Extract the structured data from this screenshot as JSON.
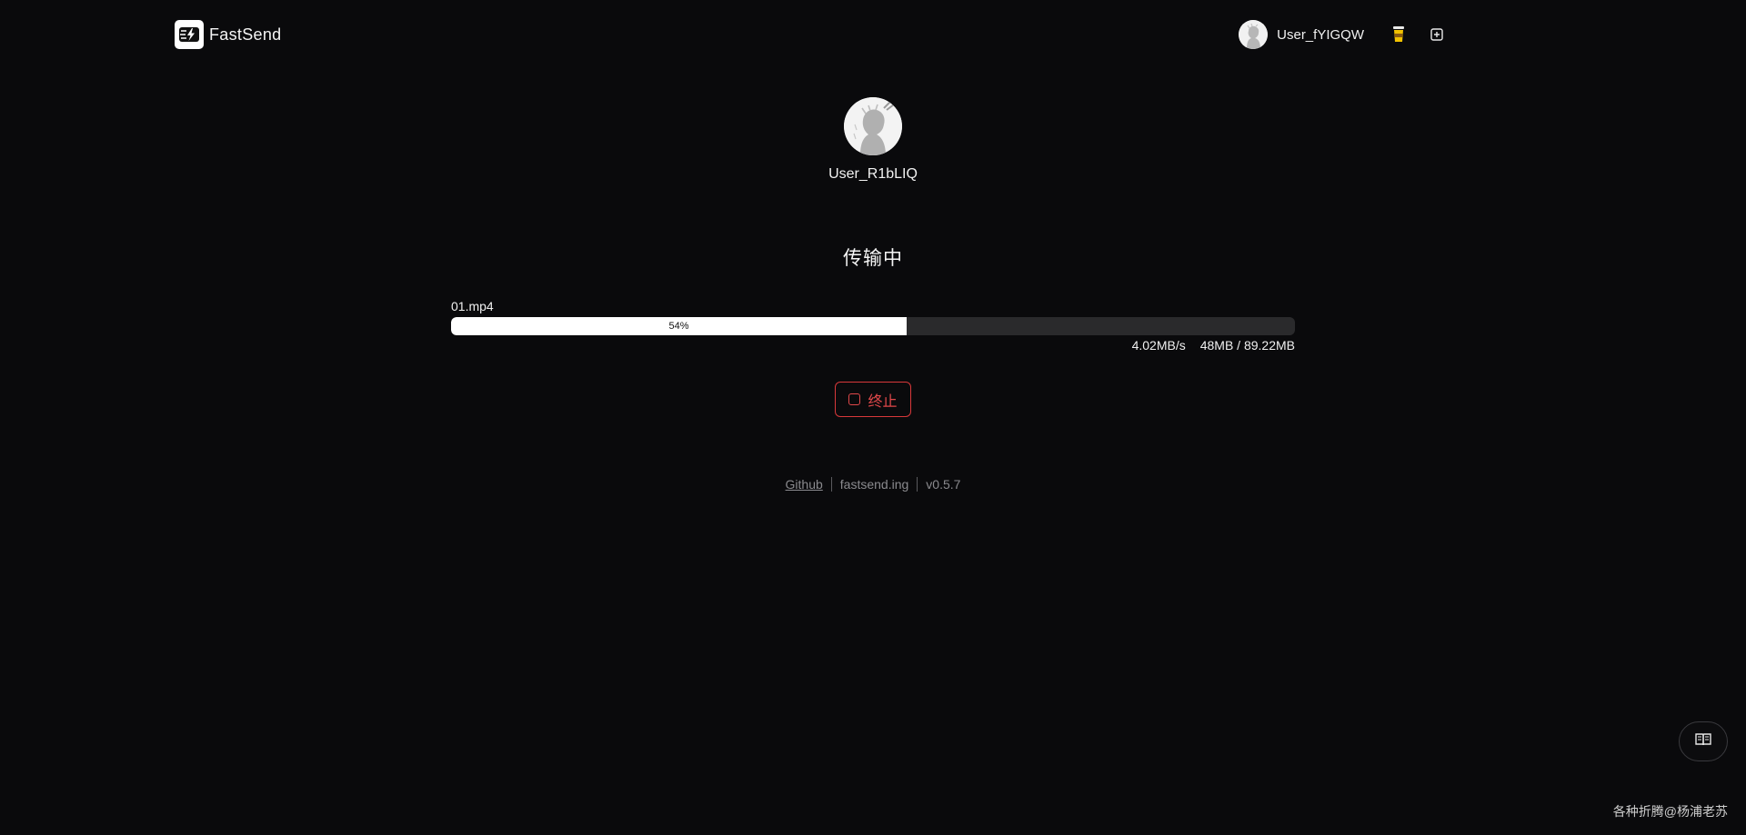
{
  "header": {
    "brand_name": "FastSend",
    "user_name": "User_fYIGQW",
    "icons": [
      "fastsend-logo-icon",
      "coffee-cup-icon",
      "plus-square-icon"
    ]
  },
  "peer": {
    "name": "User_R1bLIQ"
  },
  "transfer": {
    "status": "传输中",
    "file_name": "01.mp4",
    "progress_percent": 54,
    "progress_label": "54%",
    "speed": "4.02MB/s",
    "size_progress": "48MB / 89.22MB"
  },
  "actions": {
    "stop_label": "终止"
  },
  "footer": {
    "github_label": "Github",
    "site_label": "fastsend.ing",
    "version": "v0.5.7"
  },
  "floating": {
    "guide_icon": "book-open-icon"
  },
  "watermark": "各种折腾@杨浦老苏",
  "colors": {
    "background": "#0a0a0c",
    "progress_fill": "#ffffff",
    "progress_track": "#2a2a2c",
    "danger": "#e0484a",
    "footer_text": "#8a8a8e"
  }
}
